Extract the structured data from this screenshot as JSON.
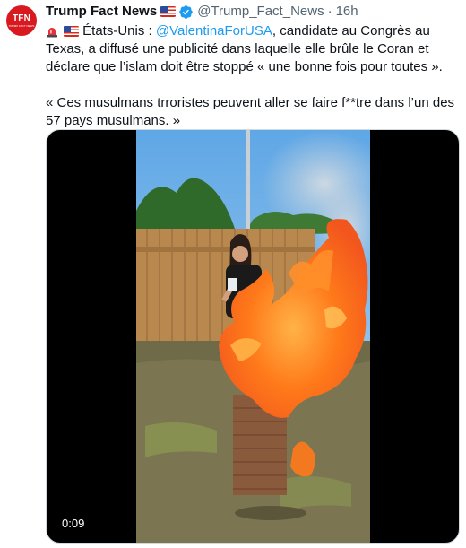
{
  "author": {
    "avatar_text": "TFN",
    "avatar_subtext": "TRUMP FACT NEWS",
    "name": "Trump Fact News",
    "handle": "@Trump_Fact_News",
    "separator": "·",
    "timestamp": "16h"
  },
  "tweet": {
    "country": "États-Unis : ",
    "mention": "@ValentinaForUSA",
    "text_after_mention": ", candidate au Congrès au Texas, a diffusé une publicité dans laquelle elle brûle le Coran et déclare que l’islam doit être stoppé « une bonne fois pour toutes ».",
    "quote": "« Ces musulmans trroristes peuvent aller se faire f**tre dans l’un des 57 pays musulmans. »"
  },
  "media": {
    "duration": "0:09"
  },
  "colors": {
    "link": "#1d9bf0",
    "secondary_text": "#536471",
    "verified": "#1d9bf0",
    "avatar_bg": "#d81a20"
  }
}
